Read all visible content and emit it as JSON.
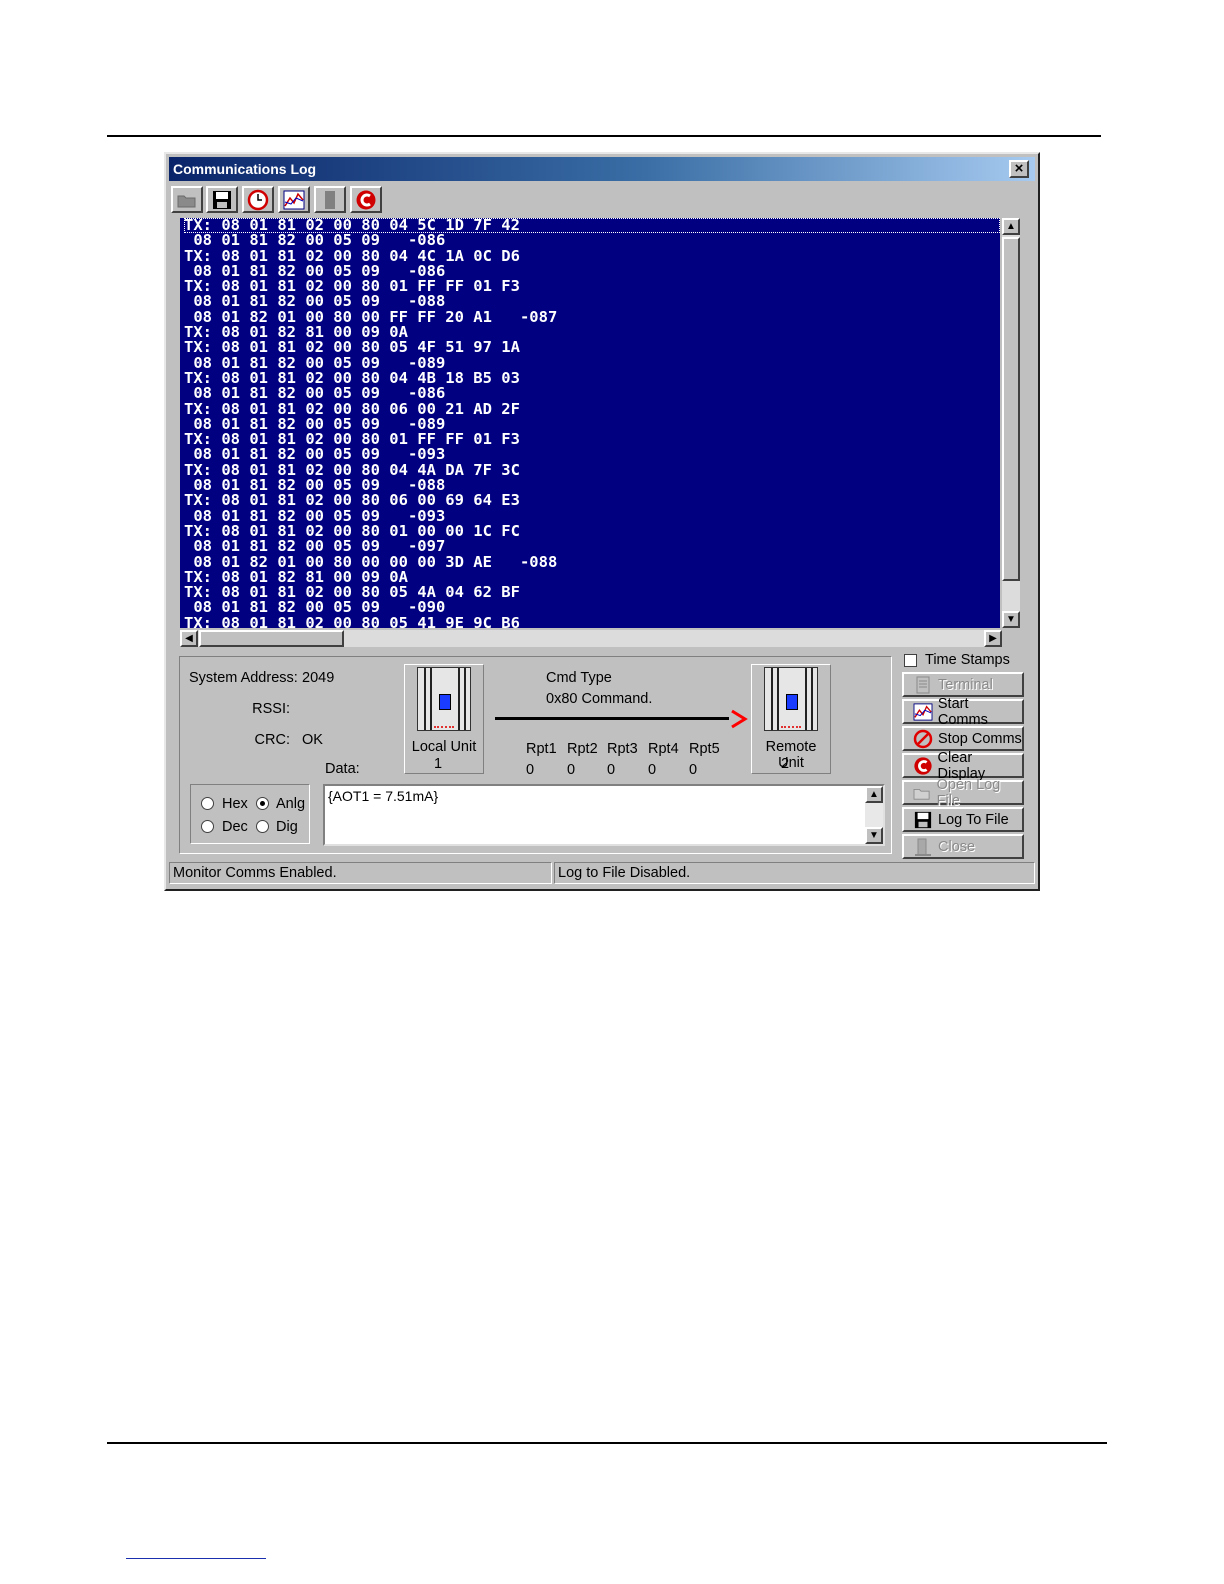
{
  "window": {
    "title": "Communications Log",
    "close_glyph": "×"
  },
  "toolbar": {
    "buttons": [
      {
        "name": "open-folder-icon"
      },
      {
        "name": "save-disk-icon"
      },
      {
        "name": "clock-icon"
      },
      {
        "name": "chart-icon"
      },
      {
        "name": "stop-block-icon"
      },
      {
        "name": "clear-c-icon"
      }
    ]
  },
  "log": {
    "lines": [
      "TX: 08 01 81 02 00 80 04 5C 1D 7F 42",
      " 08 01 81 82 00 05 09   -086",
      "TX: 08 01 81 02 00 80 04 4C 1A 0C D6",
      " 08 01 81 82 00 05 09   -086",
      "TX: 08 01 81 02 00 80 01 FF FF 01 F3",
      " 08 01 81 82 00 05 09   -088",
      " 08 01 82 01 00 80 00 FF FF 20 A1   -087",
      "TX: 08 01 82 81 00 09 0A",
      "TX: 08 01 81 02 00 80 05 4F 51 97 1A",
      " 08 01 81 82 00 05 09   -089",
      "TX: 08 01 81 02 00 80 04 4B 18 B5 03",
      " 08 01 81 82 00 05 09   -086",
      "TX: 08 01 81 02 00 80 06 00 21 AD 2F",
      " 08 01 81 82 00 05 09   -089",
      "TX: 08 01 81 02 00 80 01 FF FF 01 F3",
      " 08 01 81 82 00 05 09   -093",
      "TX: 08 01 81 02 00 80 04 4A DA 7F 3C",
      " 08 01 81 82 00 05 09   -088",
      "TX: 08 01 81 02 00 80 06 00 69 64 E3",
      " 08 01 81 82 00 05 09   -093",
      "TX: 08 01 81 02 00 80 01 00 00 1C FC",
      " 08 01 81 82 00 05 09   -097",
      " 08 01 82 01 00 80 00 00 00 3D AE   -088",
      "TX: 08 01 82 81 00 09 0A",
      "TX: 08 01 81 02 00 80 05 4A 04 62 BF",
      " 08 01 81 82 00 05 09   -090",
      "TX: 08 01 81 02 00 80 05 41 9E 9C B6"
    ]
  },
  "info": {
    "system_address_label": "System Address:",
    "system_address_value": "2049",
    "rssi_label": "RSSI:",
    "rssi_value": "",
    "crc_label": "CRC:",
    "crc_value": "OK",
    "cmd_type_label": "Cmd Type",
    "cmd_type_value": "0x80  Command.",
    "local_unit_label": "Local Unit",
    "local_unit_number": "1",
    "remote_unit_label": "Remote Unit",
    "remote_unit_number": "2",
    "arrow_glyph": ">",
    "repeaters": [
      {
        "label": "Rpt1",
        "value": "0"
      },
      {
        "label": "Rpt2",
        "value": "0"
      },
      {
        "label": "Rpt3",
        "value": "0"
      },
      {
        "label": "Rpt4",
        "value": "0"
      },
      {
        "label": "Rpt5",
        "value": "0"
      }
    ],
    "data_label": "Data:",
    "data_value": "{AOT1 = 7.51mA}"
  },
  "format_options": {
    "hex": {
      "label": "Hex",
      "selected": false
    },
    "anlg": {
      "label": "Anlg",
      "selected": true
    },
    "dec": {
      "label": "Dec",
      "selected": false
    },
    "dig": {
      "label": "Dig",
      "selected": false
    }
  },
  "side": {
    "time_stamps_label": "Time Stamps",
    "time_stamps_checked": false,
    "buttons": [
      {
        "label": "Terminal",
        "enabled": false,
        "icon": "terminal-icon"
      },
      {
        "label": "Start Comms",
        "enabled": true,
        "icon": "chart-icon"
      },
      {
        "label": "Stop Comms",
        "enabled": true,
        "icon": "no-entry-icon"
      },
      {
        "label": "Clear Display",
        "enabled": true,
        "icon": "clear-c-icon"
      },
      {
        "label": "Open Log File",
        "enabled": false,
        "icon": "open-folder-icon"
      },
      {
        "label": "Log To File",
        "enabled": true,
        "icon": "save-disk-icon"
      },
      {
        "label": "Close",
        "enabled": false,
        "icon": "door-icon"
      }
    ]
  },
  "status": {
    "monitor": "Monitor Comms Enabled.",
    "log_file": "Log to File Disabled."
  },
  "colors": {
    "log_background": "#000080",
    "arrow_red": "#ff0000",
    "title_gradient_start": "#0a246a"
  }
}
